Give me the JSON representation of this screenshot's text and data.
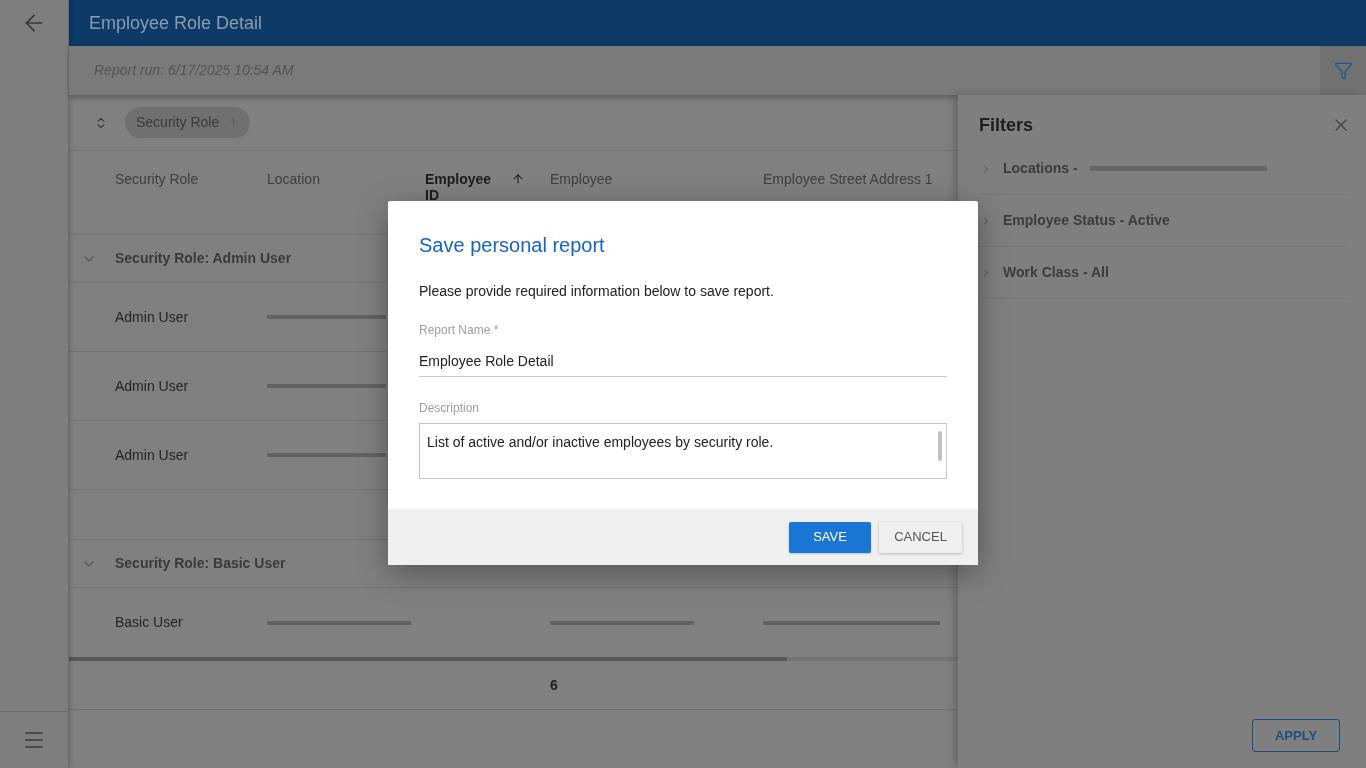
{
  "header": {
    "title": "Employee Role Detail"
  },
  "report_bar": {
    "run_info": "Report run: 6/17/2025 10:54 AM"
  },
  "group_by": {
    "chips": [
      {
        "label": "Security Role",
        "ascending": true
      }
    ]
  },
  "table": {
    "columns": [
      {
        "label": "Security Role",
        "sorted": false
      },
      {
        "label": "Location",
        "sorted": false
      },
      {
        "label": "Employee ID",
        "sorted": true
      },
      {
        "label": "Employee",
        "sorted": false
      },
      {
        "label": "Employee Street Address 1",
        "sorted": false
      }
    ],
    "groups": [
      {
        "title": "Security Role: Admin User",
        "expanded": true,
        "rows": [
          {
            "cells": [
              {
                "kind": "text",
                "text": "Admin User"
              },
              {
                "kind": "redacted"
              }
            ]
          },
          {
            "cells": [
              {
                "kind": "text",
                "text": "Admin User"
              },
              {
                "kind": "redacted"
              }
            ]
          },
          {
            "cells": [
              {
                "kind": "text",
                "text": "Admin User"
              },
              {
                "kind": "redacted"
              }
            ]
          }
        ]
      },
      {
        "title": "Security Role: Basic User",
        "expanded": true,
        "rows": [
          {
            "cells": [
              {
                "kind": "text",
                "text": "Basic User"
              },
              {
                "kind": "redacted"
              },
              {
                "kind": "blank"
              },
              {
                "kind": "redacted"
              },
              {
                "kind": "redacted"
              }
            ]
          }
        ]
      }
    ],
    "footer_row": {
      "value": "6"
    }
  },
  "filters_panel": {
    "title": "Filters",
    "items": [
      {
        "kind": "redacted",
        "label": "Locations -",
        "expanded": false
      },
      {
        "kind": "text",
        "label": "Employee Status - Active",
        "expanded": false
      },
      {
        "kind": "text",
        "label": "Work Class - All",
        "expanded": false
      }
    ],
    "apply_button": "APPLY"
  },
  "dialog": {
    "title": "Save personal report",
    "message": "Please provide required information below to save report.",
    "fields": [
      {
        "kind": "input",
        "label": "Report Name *",
        "value": "Employee Role Detail"
      },
      {
        "kind": "textarea",
        "label": "Description",
        "value": "List of active and/or inactive employees by security role."
      }
    ],
    "buttons": [
      {
        "kind": "primary",
        "label": "SAVE"
      },
      {
        "kind": "secondary",
        "label": "CANCEL"
      }
    ]
  }
}
